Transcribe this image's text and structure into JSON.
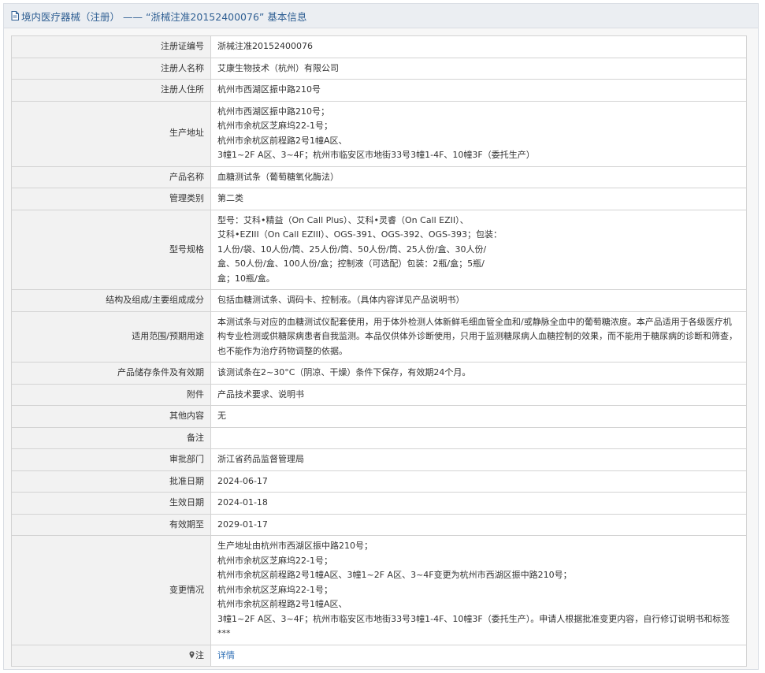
{
  "header": {
    "title": "境内医疗器械（注册） —— “浙械注准20152400076” 基本信息",
    "icon": "document-icon"
  },
  "colors": {
    "header_text": "#2f5f93",
    "label_bg": "#f2f2f2",
    "border": "#d3d3d3",
    "link": "#2f6fb5"
  },
  "rows": [
    {
      "label": "注册证编号",
      "value": "浙械注准20152400076"
    },
    {
      "label": "注册人名称",
      "value": "艾康生物技术（杭州）有限公司"
    },
    {
      "label": "注册人住所",
      "value": "杭州市西湖区振中路210号"
    },
    {
      "label": "生产地址",
      "value": "杭州市西湖区振中路210号；\n杭州市余杭区芝麻坞22-1号；\n杭州市余杭区前程路2号1幢A区、\n3幢1~2F A区、3~4F；杭州市临安区市地街33号3幢1-4F、10幢3F（委托生产）"
    },
    {
      "label": "产品名称",
      "value": "血糖测试条（葡萄糖氧化酶法）"
    },
    {
      "label": "管理类别",
      "value": "第二类"
    },
    {
      "label": "型号规格",
      "value": "型号：艾科•精益（On Call Plus）、艾科•灵睿（On Call EZII）、\n艾科•EZIII（On Call EZIII）、OGS-391、OGS-392、OGS-393；包装：\n1人份/袋、10人份/筒、25人份/筒、50人份/筒、25人份/盒、30人份/\n盒、50人份/盒、100人份/盒；控制液（可选配）包装：2瓶/盒；5瓶/\n盒；10瓶/盒。"
    },
    {
      "label": "结构及组成/主要组成成分",
      "value": "包括血糖测试条、调码卡、控制液。（具体内容详见产品说明书）"
    },
    {
      "label": "适用范围/预期用途",
      "value": "本测试条与对应的血糖测试仪配套使用，用于体外检测人体新鲜毛细血管全血和/或静脉全血中的葡萄糖浓度。本产品适用于各级医疗机构专业检测或供糖尿病患者自我监测。本品仅供体外诊断使用，只用于监测糖尿病人血糖控制的效果，而不能用于糖尿病的诊断和筛查，也不能作为治疗药物调整的依据。"
    },
    {
      "label": "产品储存条件及有效期",
      "value": "该测试条在2~30°C（阴凉、干燥）条件下保存，有效期24个月。"
    },
    {
      "label": "附件",
      "value": "产品技术要求、说明书"
    },
    {
      "label": "其他内容",
      "value": "无"
    },
    {
      "label": "备注",
      "value": ""
    },
    {
      "label": "审批部门",
      "value": "浙江省药品监督管理局"
    },
    {
      "label": "批准日期",
      "value": "2024-06-17"
    },
    {
      "label": "生效日期",
      "value": "2024-01-18"
    },
    {
      "label": "有效期至",
      "value": "2029-01-17"
    },
    {
      "label": "变更情况",
      "value": "生产地址由杭州市西湖区振中路210号；\n杭州市余杭区芝麻坞22-1号；\n杭州市余杭区前程路2号1幢A区、3幢1~2F A区、3~4F变更为杭州市西湖区振中路210号；\n杭州市余杭区芝麻坞22-1号；\n杭州市余杭区前程路2号1幢A区、\n3幢1~2F A区、3~4F；杭州市临安区市地街33号3幢1-4F、10幢3F（委托生产）。申请人根据批准变更内容，自行修订说明书和标签\n***"
    }
  ],
  "footer_row": {
    "label": "注",
    "label_icon": "map-pin-icon",
    "link": "详情"
  }
}
